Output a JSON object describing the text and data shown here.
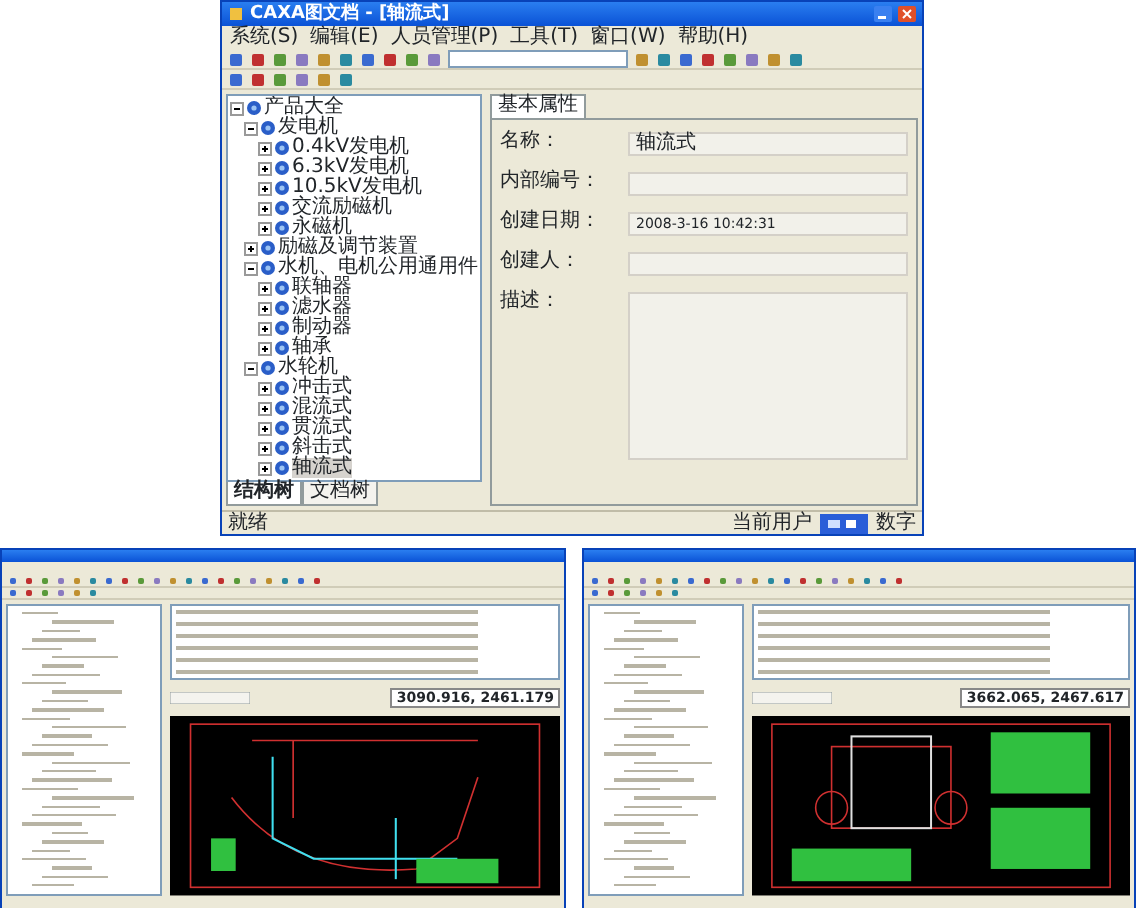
{
  "main_window": {
    "title": "CAXA图文档 - [轴流式]",
    "menu": [
      "系统(S)",
      "编辑(E)",
      "人员管理(P)",
      "工具(T)",
      "窗口(W)",
      "帮助(H)"
    ],
    "tree": [
      {
        "label": "产品大全",
        "expanded": true,
        "selected": false,
        "children": [
          {
            "label": "发电机",
            "expanded": true,
            "selected": false,
            "children": [
              {
                "label": "0.4kV发电机",
                "expanded": false,
                "selected": false
              },
              {
                "label": "6.3kV发电机",
                "expanded": false,
                "selected": false
              },
              {
                "label": "10.5kV发电机",
                "expanded": false,
                "selected": false
              },
              {
                "label": "交流励磁机",
                "expanded": false,
                "selected": false
              },
              {
                "label": "永磁机",
                "expanded": false,
                "selected": false
              }
            ]
          },
          {
            "label": "励磁及调节装置",
            "expanded": false,
            "selected": false
          },
          {
            "label": "水机、电机公用通用件",
            "expanded": true,
            "selected": false,
            "children": [
              {
                "label": "联轴器",
                "expanded": false,
                "selected": false
              },
              {
                "label": "滤水器",
                "expanded": false,
                "selected": false
              },
              {
                "label": "制动器",
                "expanded": false,
                "selected": false
              },
              {
                "label": "轴承",
                "expanded": false,
                "selected": false
              }
            ]
          },
          {
            "label": "水轮机",
            "expanded": true,
            "selected": false,
            "children": [
              {
                "label": "冲击式",
                "expanded": false,
                "selected": false
              },
              {
                "label": "混流式",
                "expanded": false,
                "selected": false
              },
              {
                "label": "贯流式",
                "expanded": false,
                "selected": false
              },
              {
                "label": "斜击式",
                "expanded": false,
                "selected": false
              },
              {
                "label": "轴流式",
                "expanded": false,
                "selected": true
              }
            ]
          }
        ]
      }
    ],
    "tree_tabs": [
      {
        "label": "结构树",
        "selected": true
      },
      {
        "label": "文档树",
        "selected": false
      }
    ],
    "properties_tab": "基本属性",
    "fields": [
      {
        "label": "名称：",
        "value": "轴流式",
        "kind": "line"
      },
      {
        "label": "内部编号：",
        "kind": "line"
      },
      {
        "label": "创建日期：",
        "value": "2008-3-16 10:42:31",
        "kind": "line"
      },
      {
        "label": "创建人：",
        "kind": "line"
      },
      {
        "label": "描述：",
        "kind": "area"
      }
    ],
    "status_bar": {
      "message": "就绪",
      "user_label": "当前用户",
      "mode": "数字"
    }
  },
  "preview_windows": [
    {
      "coordinates": "3090.916, 2461.179"
    },
    {
      "coordinates": "3662.065, 2467.617"
    }
  ]
}
